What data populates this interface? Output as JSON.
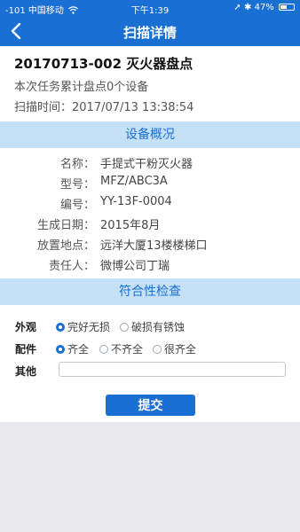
{
  "status_bar": {
    "carrier": "-101 中国移动",
    "wifi_icon": "wifi-icon",
    "time": "下午1:39",
    "location_icon": "location-arrow-icon",
    "bluetooth_icon": "bluetooth-icon",
    "battery_percent": "47%",
    "battery_level": 0.47
  },
  "nav": {
    "back_icon": "chevron-left-icon",
    "title": "扫描详情"
  },
  "task": {
    "title": "20170713-002 灭火器盘点",
    "summary": "本次任务累计盘点0个设备",
    "scan_time": "扫描时间：2017/07/13 13:38:54"
  },
  "overview": {
    "header": "设备概况",
    "rows": [
      {
        "label": "名称：",
        "value": "手提式干粉灭火器"
      },
      {
        "label": "型号：",
        "value": "MFZ/ABC3A"
      },
      {
        "label": "编号：",
        "value": "YY-13F-0004"
      },
      {
        "label": "生成日期：",
        "value": "2015年8月"
      },
      {
        "label": "放置地点：",
        "value": "远洋大厦13楼楼梯口"
      },
      {
        "label": "责任人：",
        "value": "微博公司丁瑞"
      }
    ]
  },
  "compliance": {
    "header": "符合性检查",
    "appearance": {
      "label": "外观",
      "options": [
        {
          "label": "完好无损",
          "selected": true
        },
        {
          "label": "破损有锈蚀",
          "selected": false
        }
      ]
    },
    "parts": {
      "label": "配件",
      "options": [
        {
          "label": "齐全",
          "selected": true
        },
        {
          "label": "不齐全",
          "selected": false
        },
        {
          "label": "很齐全",
          "selected": false
        }
      ]
    },
    "other": {
      "label": "其他",
      "value": ""
    },
    "submit_label": "提交"
  },
  "colors": {
    "primary": "#1a6fd3",
    "section_bg": "#c6e0f6",
    "page_bg": "#e8e8ed"
  }
}
